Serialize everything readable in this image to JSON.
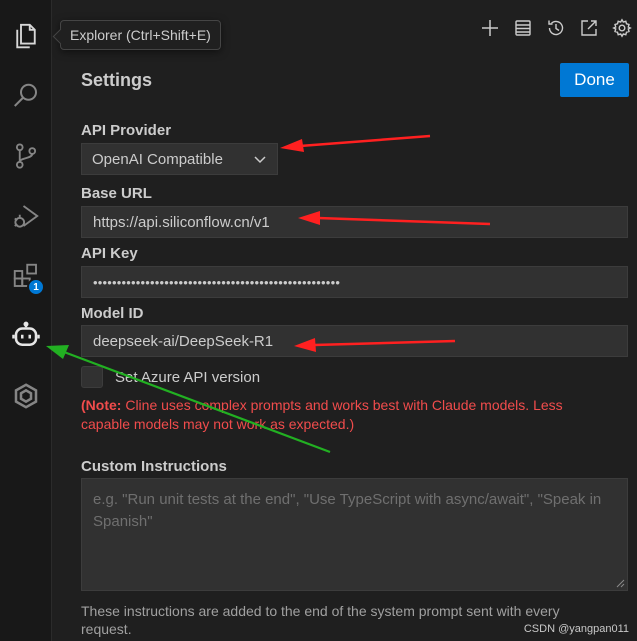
{
  "tooltip": {
    "text": "Explorer (Ctrl+Shift+E)"
  },
  "activity_bar": {
    "items": [
      {
        "name": "explorer",
        "icon": "files-icon"
      },
      {
        "name": "search",
        "icon": "search-icon"
      },
      {
        "name": "source-control",
        "icon": "source-control-icon"
      },
      {
        "name": "run-debug",
        "icon": "run-debug-icon"
      },
      {
        "name": "extensions",
        "icon": "extensions-icon",
        "badge": "1"
      },
      {
        "name": "cline",
        "icon": "robot-icon"
      },
      {
        "name": "other-extension",
        "icon": "hexagon-icon"
      }
    ]
  },
  "toolbar": {
    "icons": [
      "plus-icon",
      "history-list-icon",
      "history-clock-icon",
      "open-external-icon",
      "settings-gear-icon"
    ]
  },
  "settings": {
    "title": "Settings",
    "done_label": "Done",
    "api_provider_label": "API Provider",
    "api_provider_value": "OpenAI Compatible",
    "base_url_label": "Base URL",
    "base_url_value": "https://api.siliconflow.cn/v1",
    "api_key_label": "API Key",
    "api_key_value": "••••••••••••••••••••••••••••••••••••••••••••••••••••",
    "model_id_label": "Model ID",
    "model_id_value": "deepseek-ai/DeepSeek-R1",
    "azure_checkbox_label": "Set Azure API version",
    "azure_checkbox_checked": false,
    "note_prefix": "(Note:",
    "note_text": " Cline uses complex prompts and works best with Claude models. Less capable models may not work as expected.)",
    "custom_instructions_label": "Custom Instructions",
    "custom_instructions_placeholder": "e.g. \"Run unit tests at the end\", \"Use TypeScript with async/await\", \"Speak in Spanish\"",
    "custom_instructions_hint": "These instructions are added to the end of the system prompt sent with every request."
  },
  "watermark": "CSDN @yangpan011",
  "colors": {
    "accent": "#0078d4",
    "warning": "#f14c4c",
    "annotation_red": "#ff2020",
    "annotation_green": "#22b022"
  }
}
